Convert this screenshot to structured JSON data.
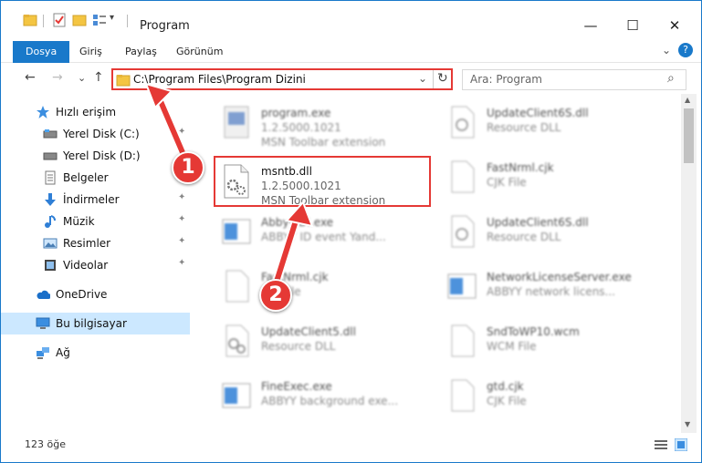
{
  "window": {
    "title": "Program",
    "minimize": "—",
    "maximize": "☐",
    "close": "✕"
  },
  "ribbon": {
    "tabs": [
      "Dosya",
      "Giriş",
      "Paylaş",
      "Görünüm"
    ],
    "expand": "⌄",
    "help": "?"
  },
  "nav": {
    "back": "←",
    "forward": "→",
    "recent": "⌄",
    "up": "↑",
    "address": "C:\\Program Files\\Program Dizini",
    "dropdown": "⌄",
    "refresh": "↻",
    "search_placeholder": "Ara: Program",
    "search_icon": "⌕"
  },
  "sidebar": {
    "items": [
      {
        "label": "Hızlı erişim",
        "icon": "star-icon",
        "pinned": false
      },
      {
        "label": "Yerel Disk (C:)",
        "icon": "drive-icon",
        "pinned": true
      },
      {
        "label": "Yerel Disk (D:)",
        "icon": "drive-icon",
        "pinned": true
      },
      {
        "label": "Belgeler",
        "icon": "documents-icon",
        "pinned": true
      },
      {
        "label": "İndirmeler",
        "icon": "download-icon",
        "pinned": true
      },
      {
        "label": "Müzik",
        "icon": "music-icon",
        "pinned": true
      },
      {
        "label": "Resimler",
        "icon": "pictures-icon",
        "pinned": true
      },
      {
        "label": "Videolar",
        "icon": "video-icon",
        "pinned": true
      },
      {
        "label": "OneDrive",
        "icon": "cloud-icon",
        "pinned": false
      },
      {
        "label": "Bu bilgisayar",
        "icon": "computer-icon",
        "pinned": false
      },
      {
        "label": "Ağ",
        "icon": "network-icon",
        "pinned": false
      }
    ],
    "pin_glyph": "📌"
  },
  "files": [
    {
      "name": "program.exe",
      "line2": "1.2.5000.1021",
      "line3": "MSN Toolbar extension",
      "icon": "exe-icon"
    },
    {
      "name": "UpdateClient6S.dll",
      "line2": "Resource DLL",
      "line3": "",
      "icon": "dll-icon"
    },
    {
      "name": "msntb.dll",
      "line2": "1.2.5000.1021",
      "line3": "MSN Toolbar extension",
      "icon": "dll-gear-icon"
    },
    {
      "name": "FastNrml.cjk",
      "line2": "CJK File",
      "line3": "",
      "icon": "file-icon"
    },
    {
      "name": "AbbyyIDI.exe",
      "line2": "ABBYY ID event Yand...",
      "line3": "",
      "icon": "app-icon"
    },
    {
      "name": "UpdateClient6S.dll",
      "line2": "Resource DLL",
      "line3": "",
      "icon": "dll-icon"
    },
    {
      "name": "FastNrml.cjk",
      "line2": "CJK File",
      "line3": "",
      "icon": "file-icon"
    },
    {
      "name": "NetworkLicenseServer.exe",
      "line2": "ABBYY network licens...",
      "line3": "",
      "icon": "app-icon"
    },
    {
      "name": "UpdateClient5.dll",
      "line2": "Resource DLL",
      "line3": "",
      "icon": "dll-gear-icon"
    },
    {
      "name": "SndToWP10.wcm",
      "line2": "WCM File",
      "line3": "",
      "icon": "file-icon"
    },
    {
      "name": "FineExec.exe",
      "line2": "ABBYY background exe...",
      "line3": "",
      "icon": "app-icon"
    },
    {
      "name": "gtd.cjk",
      "line2": "CJK File",
      "line3": "",
      "icon": "file-icon"
    }
  ],
  "status": {
    "count": "123 öğe"
  },
  "callouts": [
    "1",
    "2"
  ],
  "colors": {
    "accent": "#1979ca",
    "highlight": "#e53935",
    "selected_nav": "#cce8ff"
  }
}
